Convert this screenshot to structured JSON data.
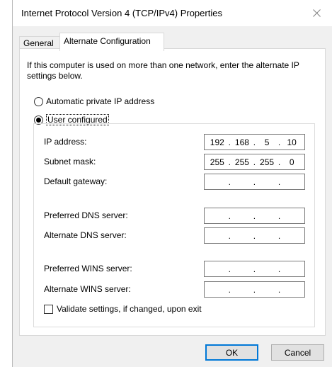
{
  "window": {
    "title": "Internet Protocol Version 4 (TCP/IPv4) Properties",
    "close_icon": "close-icon"
  },
  "tabs": [
    {
      "label": "General",
      "active": false
    },
    {
      "label": "Alternate Configuration",
      "active": true
    }
  ],
  "description": "If this computer is used on more than one network, enter the alternate IP settings below.",
  "radios": {
    "automatic": {
      "label": "Automatic private IP address",
      "selected": false
    },
    "user": {
      "label": "User configured",
      "selected": true
    }
  },
  "fields": [
    {
      "label": "IP address:",
      "value": [
        "192",
        "168",
        "5",
        "10"
      ]
    },
    {
      "label": "Subnet mask:",
      "value": [
        "255",
        "255",
        "255",
        "0"
      ]
    },
    {
      "label": "Default gateway:",
      "value": [
        "",
        "",
        "",
        ""
      ]
    },
    {
      "label": "Preferred DNS server:",
      "value": [
        "",
        "",
        "",
        ""
      ]
    },
    {
      "label": "Alternate DNS server:",
      "value": [
        "",
        "",
        "",
        ""
      ]
    },
    {
      "label": "Preferred WINS server:",
      "value": [
        "",
        "",
        "",
        ""
      ]
    },
    {
      "label": "Alternate WINS server:",
      "value": [
        "",
        "",
        "",
        ""
      ]
    }
  ],
  "validate": {
    "label": "Validate settings, if changed, upon exit",
    "checked": false
  },
  "buttons": {
    "ok": "OK",
    "cancel": "Cancel"
  },
  "colors": {
    "accent": "#0078d7",
    "dialog_bg": "#f0f0f0"
  }
}
